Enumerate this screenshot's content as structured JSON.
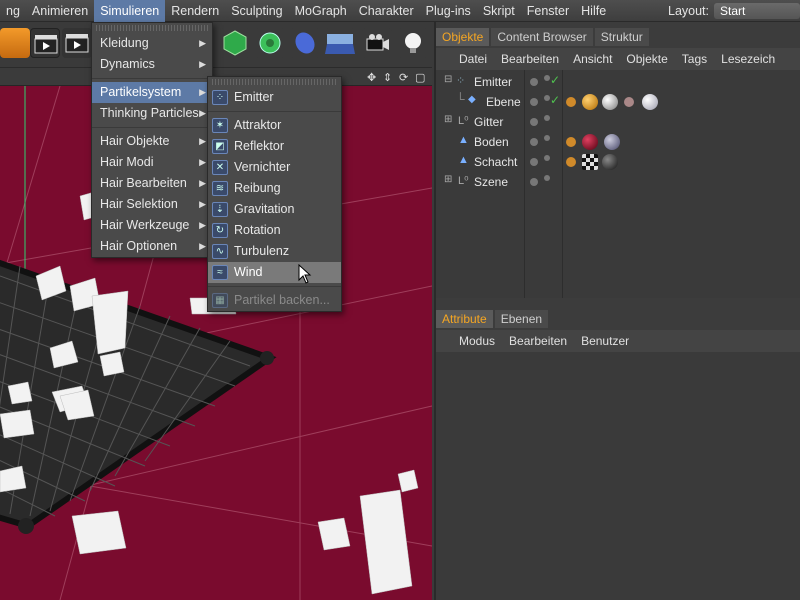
{
  "menubar": {
    "items": [
      "ng",
      "Animieren",
      "Simulieren",
      "Rendern",
      "Sculpting",
      "MoGraph",
      "Charakter",
      "Plug-ins",
      "Skript",
      "Fenster",
      "Hilfe"
    ],
    "layout_label": "Layout:",
    "layout_value": "Start"
  },
  "simulieren_menu": {
    "items": [
      {
        "label": "Kleidung",
        "has_submenu": true
      },
      {
        "label": "Dynamics",
        "has_submenu": true
      },
      {
        "label": "Partikelsystem",
        "has_submenu": true
      },
      {
        "label": "Thinking Particles",
        "has_submenu": true
      },
      {
        "label": "Hair Objekte",
        "has_submenu": true
      },
      {
        "label": "Hair Modi",
        "has_submenu": true
      },
      {
        "label": "Hair Bearbeiten",
        "has_submenu": true
      },
      {
        "label": "Hair Selektion",
        "has_submenu": true
      },
      {
        "label": "Hair Werkzeuge",
        "has_submenu": true
      },
      {
        "label": "Hair Optionen",
        "has_submenu": true
      }
    ]
  },
  "partikel_menu": {
    "items": [
      "Emitter",
      "Attraktor",
      "Reflektor",
      "Vernichter",
      "Reibung",
      "Gravitation",
      "Rotation",
      "Turbulenz",
      "Wind",
      "Partikel backen..."
    ]
  },
  "objects_panel": {
    "tabs": [
      "Objekte",
      "Content Browser",
      "Struktur"
    ],
    "menu": [
      "Datei",
      "Bearbeiten",
      "Ansicht",
      "Objekte",
      "Tags",
      "Lesezeich"
    ],
    "rows": [
      "Emitter",
      "Ebene",
      "Gitter",
      "Boden",
      "Schacht",
      "Szene"
    ]
  },
  "attributes_panel": {
    "tabs": [
      "Attribute",
      "Ebenen"
    ],
    "menu": [
      "Modus",
      "Bearbeiten",
      "Benutzer"
    ]
  },
  "colors": {
    "viewport": "#7a0b2e",
    "highlight": "#5d7aa6",
    "active_tab": "#f5a623"
  }
}
